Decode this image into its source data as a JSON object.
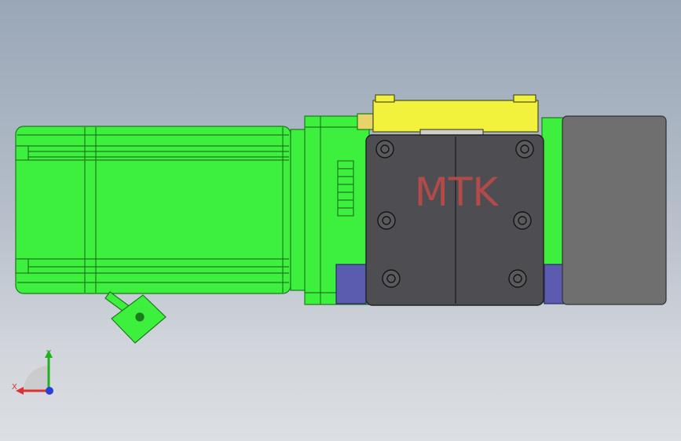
{
  "label": {
    "text": "MTK",
    "color": "#b34a4a"
  },
  "colors": {
    "motor_green": "#3ef03e",
    "motor_edge": "#1d7a1d",
    "bracket_yellow": "#f2f23c",
    "housing_dark": "#4e4e52",
    "cover_gray": "#6f6f6f",
    "block_blue": "#5b5bb0"
  },
  "triad": {
    "x_label": "X",
    "y_label": "Y",
    "x_color": "#e03030",
    "y_color": "#21b021",
    "z_color": "#2a3fd8"
  }
}
